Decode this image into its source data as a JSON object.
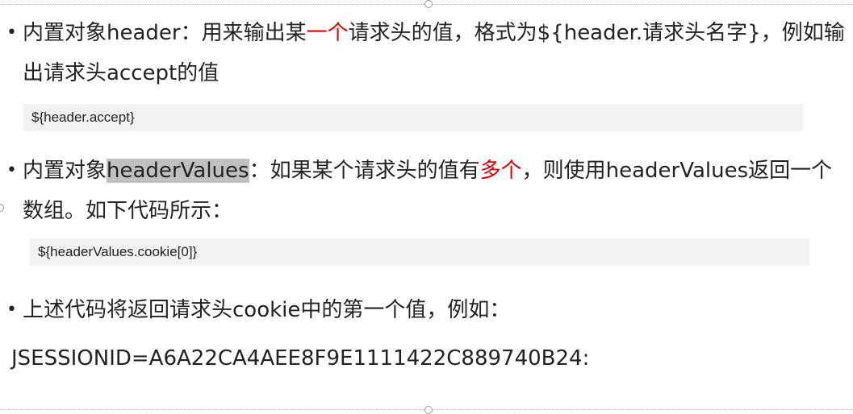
{
  "items": [
    {
      "pre": "内置对象header：用来输出某",
      "red": "一个",
      "post": "请求头的值，格式为${header.请求头名字}，例如输出请求头accept的值"
    },
    {
      "pre": "内置对象",
      "highlight": "headerValues",
      "mid": "：如果某个请求头的值有",
      "red": "多个",
      "post": "，则使用headerValues返回一个数组。如下代码所示："
    },
    {
      "text": "上述代码将返回请求头cookie中的第一个值，例如："
    }
  ],
  "code": [
    "${header.accept}",
    "${headerValues.cookie[0]}"
  ],
  "result": "JSESSIONID=A6A22CA4AEE8F9E1111422C889740B24:",
  "colors": {
    "emphasis": "#e00000",
    "code_bg": "#f2f2f2",
    "selection": "#c0c0c0"
  }
}
